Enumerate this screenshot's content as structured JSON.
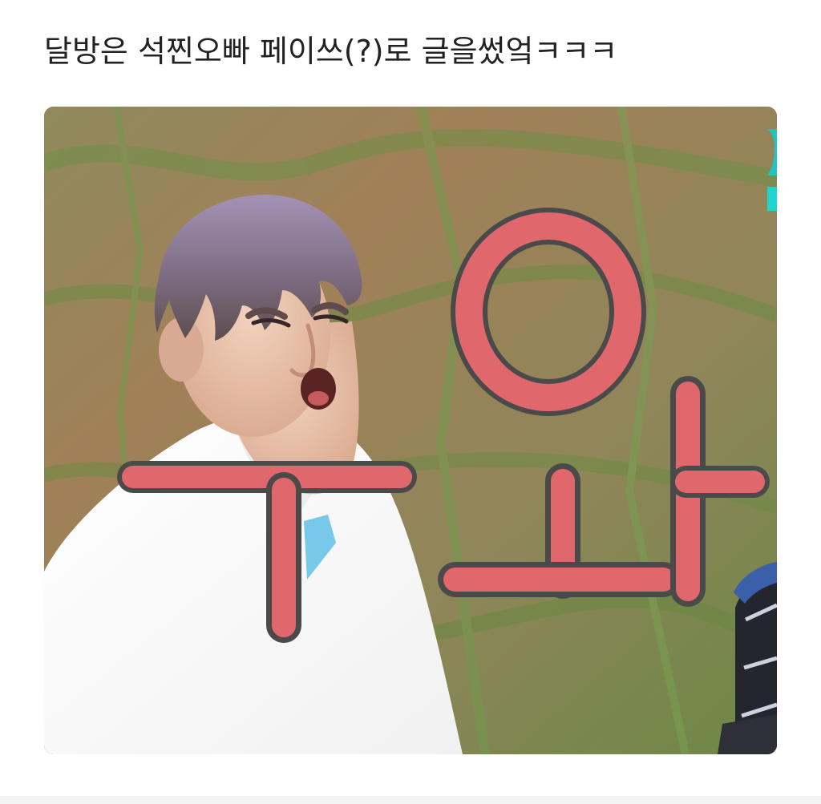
{
  "post": {
    "text": "달방은 석찐오빠 페이쓰(?)로 글을썼엌ㅋㅋㅋ"
  },
  "image": {
    "caption_overlay": "우와"
  },
  "colors": {
    "caption_fill": "#e0686c",
    "caption_outline": "#4a4a4a",
    "background_grass": "#7f8f52",
    "background_soil": "#9d7d57",
    "shirt": "#fbfbfb",
    "hair": "#8a7a98"
  }
}
